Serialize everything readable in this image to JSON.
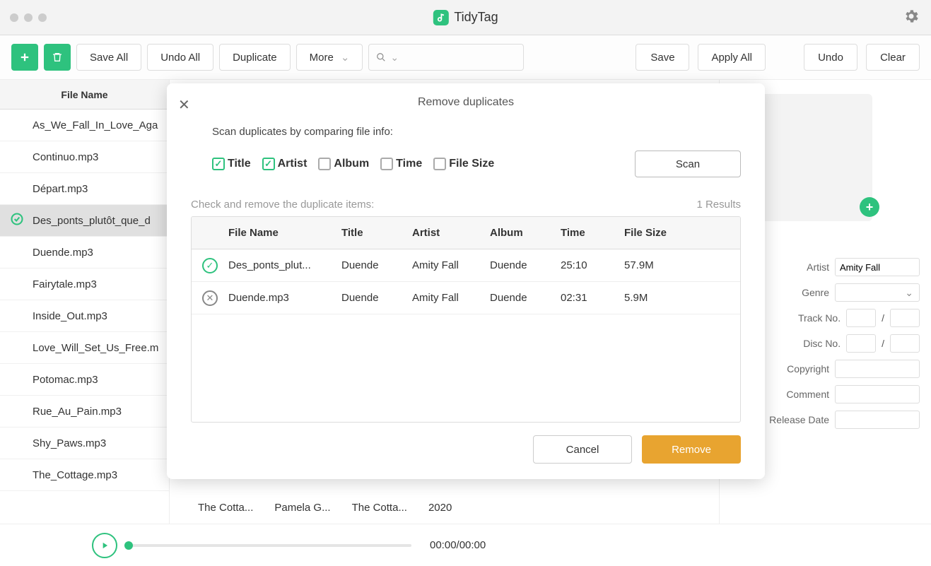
{
  "app": {
    "title": "TidyTag"
  },
  "toolbar": {
    "save_all": "Save All",
    "undo_all": "Undo All",
    "duplicate": "Duplicate",
    "more": "More",
    "save": "Save",
    "apply_all": "Apply All",
    "undo": "Undo",
    "clear": "Clear"
  },
  "filelist": {
    "header": "File Name",
    "items": [
      {
        "name": "As_We_Fall_In_Love_Aga",
        "selected": false
      },
      {
        "name": "Continuo.mp3",
        "selected": false
      },
      {
        "name": "Départ.mp3",
        "selected": false
      },
      {
        "name": "Des_ponts_plutôt_que_d",
        "selected": true
      },
      {
        "name": "Duende.mp3",
        "selected": false
      },
      {
        "name": "Fairytale.mp3",
        "selected": false
      },
      {
        "name": "Inside_Out.mp3",
        "selected": false
      },
      {
        "name": "Love_Will_Set_Us_Free.m",
        "selected": false
      },
      {
        "name": "Potomac.mp3",
        "selected": false
      },
      {
        "name": "Rue_Au_Pain.mp3",
        "selected": false
      },
      {
        "name": "Shy_Paws.mp3",
        "selected": false
      },
      {
        "name": "The_Cottage.mp3",
        "selected": false
      }
    ],
    "extra_row": {
      "title": "The Cotta...",
      "artist": "Pamela G...",
      "album": "The Cotta...",
      "year": "2020"
    }
  },
  "sidepanel": {
    "fields": {
      "artist_label": "Artist",
      "artist_value": "Amity Fall",
      "genre_label": "Genre",
      "trackno_label": "Track No.",
      "discno_label": "Disc No.",
      "copyright_label": "Copyright",
      "comment_label": "Comment",
      "release_label": "Release Date",
      "sep": "/"
    }
  },
  "player": {
    "time": "00:00/00:00"
  },
  "modal": {
    "title": "Remove duplicates",
    "scan_label": "Scan duplicates by comparing file info:",
    "options": {
      "title": {
        "label": "Title",
        "checked": true
      },
      "artist": {
        "label": "Artist",
        "checked": true
      },
      "album": {
        "label": "Album",
        "checked": false
      },
      "time": {
        "label": "Time",
        "checked": false
      },
      "filesize": {
        "label": "File Size",
        "checked": false
      }
    },
    "scan_button": "Scan",
    "results_label": "Check and remove the duplicate items:",
    "results_count": "1 Results",
    "columns": [
      "File Name",
      "Title",
      "Artist",
      "Album",
      "Time",
      "File Size"
    ],
    "rows": [
      {
        "status": "keep",
        "file": "Des_ponts_plut...",
        "title": "Duende",
        "artist": "Amity Fall",
        "album": "Duende",
        "time": "25:10",
        "size": "57.9M"
      },
      {
        "status": "remove",
        "file": "Duende.mp3",
        "title": "Duende",
        "artist": "Amity Fall",
        "album": "Duende",
        "time": "02:31",
        "size": "5.9M"
      }
    ],
    "cancel": "Cancel",
    "remove": "Remove"
  }
}
